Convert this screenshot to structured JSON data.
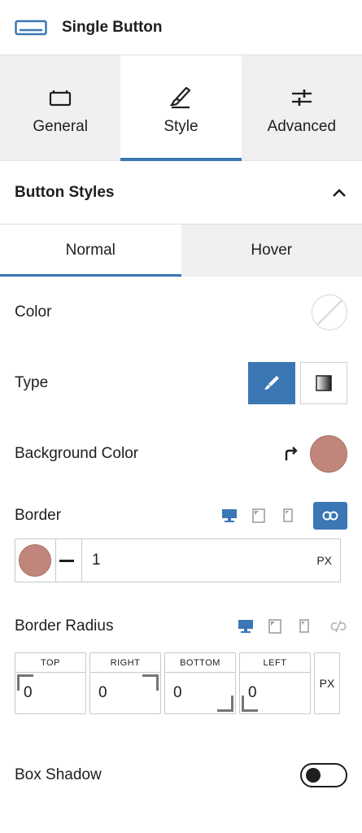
{
  "header": {
    "title": "Single Button",
    "icon": "button-block-icon"
  },
  "tabs": [
    {
      "label": "General",
      "icon": "toolbox-icon",
      "active": false
    },
    {
      "label": "Style",
      "icon": "brush-icon",
      "active": true
    },
    {
      "label": "Advanced",
      "icon": "sliders-icon",
      "active": false
    }
  ],
  "section": {
    "title": "Button Styles",
    "expanded": true
  },
  "state_tabs": [
    {
      "label": "Normal",
      "active": true
    },
    {
      "label": "Hover",
      "active": false
    }
  ],
  "fields": {
    "color": {
      "label": "Color",
      "value": "none"
    },
    "type": {
      "label": "Type",
      "options": [
        "classic-brush-icon",
        "gradient-icon"
      ],
      "selected": "classic-brush-icon"
    },
    "background_color": {
      "label": "Background Color",
      "value": "#c0867b"
    },
    "border": {
      "label": "Border",
      "color": "#c0867b",
      "style": "solid",
      "width": "1",
      "unit": "PX",
      "linked": true
    },
    "border_radius": {
      "label": "Border Radius",
      "top_label": "TOP",
      "right_label": "RIGHT",
      "bottom_label": "BOTTOM",
      "left_label": "LEFT",
      "top": "0",
      "right": "0",
      "bottom": "0",
      "left": "0",
      "unit": "PX",
      "linked": false
    },
    "box_shadow": {
      "label": "Box Shadow",
      "enabled": false
    }
  },
  "colors": {
    "accent": "#3b77b5",
    "tab_bg": "#f0f0f1",
    "swatch": "#c0867b"
  }
}
